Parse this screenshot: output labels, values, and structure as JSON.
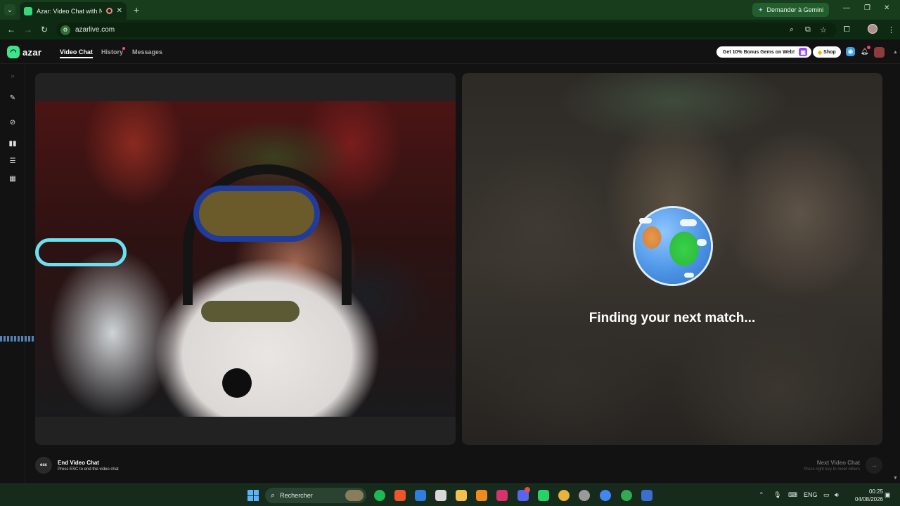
{
  "browser": {
    "tab_title": "Azar: Video Chat with New",
    "new_tab": "+",
    "gemini_label": "Demander à Gemini",
    "url": "azarlive.com"
  },
  "app": {
    "logo_text": "azar",
    "nav": {
      "video_chat": "Video Chat",
      "history": "History",
      "messages": "Messages"
    },
    "gems_promo": "Get 10% Bonus Gems on Web!",
    "shop_label": "Shop",
    "finding_text": "Finding your next match...",
    "end_chat": {
      "badge": "esc",
      "title": "End Video Chat",
      "subtitle": "Press ESC to end the video chat"
    },
    "next_chat": {
      "title": "Next Video Chat",
      "subtitle": "Press right key to meet others"
    }
  },
  "taskbar": {
    "search_placeholder": "Rechercher",
    "lang": "ENG",
    "time": "00:25",
    "date": "04/08/2026"
  },
  "colors": {
    "accent_green": "#3ee58a",
    "browser_frame": "#173d1c",
    "app_bg": "#121212"
  },
  "icons": [
    "chevron-down-icon",
    "record-icon",
    "close-icon",
    "sparkle-icon",
    "back-icon",
    "forward-icon",
    "reload-icon",
    "zoom-icon",
    "install-icon",
    "star-icon",
    "extensions-icon",
    "menu-icon",
    "gift-icon",
    "gem-icon",
    "chat-icon",
    "bell-icon",
    "magic-wand-icon",
    "no-filter-icon",
    "layout-side-icon",
    "layout-stack-icon",
    "layout-grid-icon",
    "globe-icon",
    "arrow-right-icon",
    "windows-start-icon",
    "search-icon"
  ]
}
